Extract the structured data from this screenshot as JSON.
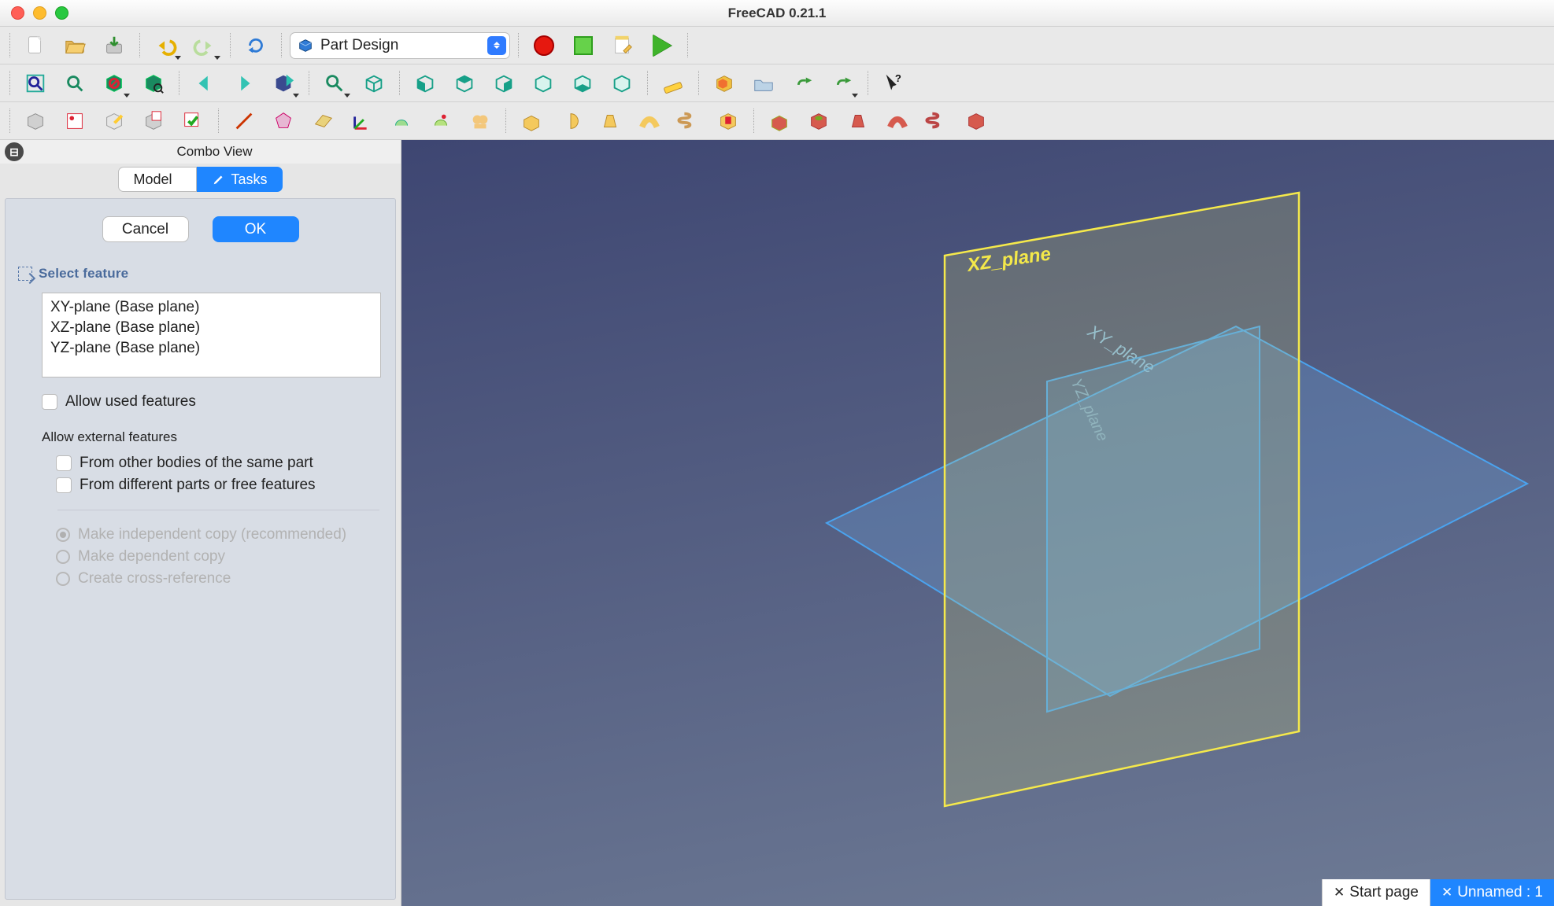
{
  "app": {
    "title": "FreeCAD 0.21.1"
  },
  "toolbar1": {
    "workbench": "Part Design",
    "btns": {
      "new": "new-document-icon",
      "open": "open-document-icon",
      "save": "save-document-icon",
      "undo": "undo-icon",
      "redo": "redo-icon",
      "refresh": "refresh-icon",
      "macro_record": "macro-record-icon",
      "macro_stop": "macro-stop-icon",
      "macro_edit": "macro-edit-icon",
      "macro_play": "macro-play-icon"
    }
  },
  "toolbar2": {
    "btns": [
      "fit-all-icon",
      "fit-selection-icon",
      "toggle-visibility-icon",
      "bounding-box-icon",
      "nav-back-icon",
      "nav-forward-icon",
      "link-icon",
      "zoom-icon",
      "isometric-icon",
      "view-front-icon",
      "view-top-icon",
      "view-right-icon",
      "view-rear-icon",
      "view-bottom-icon",
      "view-left-icon",
      "measure-icon",
      "appearance-icon",
      "open-folder-icon",
      "export-link-icon",
      "sublink-icon",
      "whats-this-icon"
    ]
  },
  "toolbar3": {
    "btns": [
      "create-body-icon",
      "create-sketch-icon",
      "import-sketch-icon",
      "edit-sketch-icon",
      "validate-sketch-icon",
      "create-line-icon",
      "create-wire-icon",
      "create-polyline-icon",
      "datum-point-icon",
      "datum-plane-icon",
      "shape-binder-icon",
      "pad-icon",
      "revolution-icon",
      "loft-icon",
      "sweep-icon",
      "helix-icon",
      "groove-icon",
      "pocket-icon",
      "hole-icon",
      "subloft-icon",
      "subsweep-icon",
      "subhelix-icon",
      "subgroove-icon"
    ]
  },
  "combo": {
    "title": "Combo View",
    "tabs": {
      "model": "Model",
      "tasks": "Tasks",
      "active": "tasks"
    },
    "task": {
      "cancel": "Cancel",
      "ok": "OK",
      "section_title": "Select feature",
      "planes": [
        "XY-plane (Base plane)",
        "XZ-plane (Base plane)",
        "YZ-plane (Base plane)"
      ],
      "allow_used": "Allow used features",
      "ext_title": "Allow external features",
      "ext_same_part": "From other bodies of the same part",
      "ext_free": "From different parts or free features",
      "radio_independent": "Make independent copy (recommended)",
      "radio_dependent": "Make dependent copy",
      "radio_crossref": "Create cross-reference"
    }
  },
  "viewport": {
    "labels": {
      "xz": "XZ_plane",
      "xy": "XY_plane",
      "yz": "YZ_plane"
    }
  },
  "doctabs": {
    "start": "Start page",
    "active": "Unnamed : 1"
  }
}
